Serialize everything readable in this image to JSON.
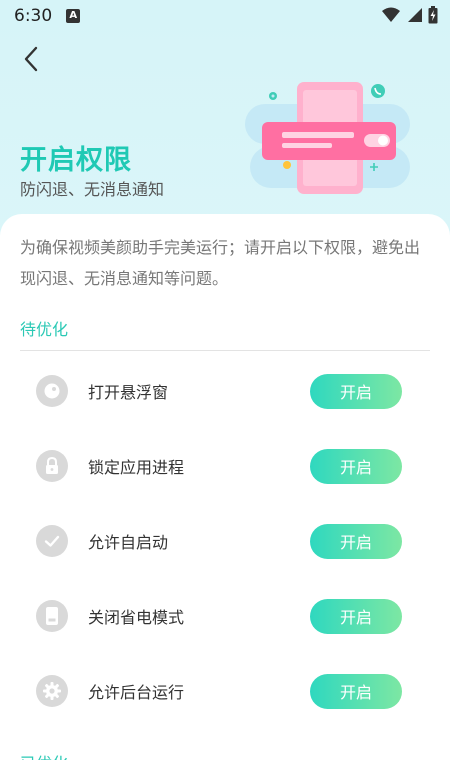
{
  "status": {
    "time": "6:30",
    "a_badge": "A"
  },
  "header": {
    "title": "开启权限",
    "subtitle": "防闪退、无消息通知"
  },
  "description": "为确保视频美颜助手完美运行；请开启以下权限，避免出现闪退、无消息通知等问题。",
  "section_pending": "待优化",
  "section_done": "已优化",
  "permissions": [
    {
      "label": "打开悬浮窗",
      "button": "开启",
      "icon": "floating-window-icon"
    },
    {
      "label": "锁定应用进程",
      "button": "开启",
      "icon": "lock-icon"
    },
    {
      "label": "允许自启动",
      "button": "开启",
      "icon": "check-icon"
    },
    {
      "label": "关闭省电模式",
      "button": "开启",
      "icon": "battery-icon"
    },
    {
      "label": "允许后台运行",
      "button": "开启",
      "icon": "gear-icon"
    }
  ],
  "colors": {
    "accent": "#1fc9b4",
    "button_start": "#2fd8bf",
    "button_end": "#7de7a3",
    "icon_bg": "#d9d9d9"
  }
}
